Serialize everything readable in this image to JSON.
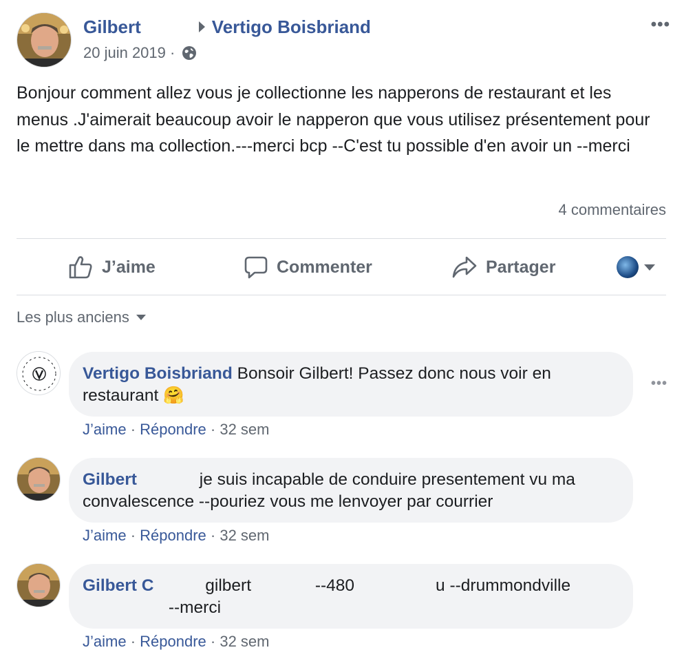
{
  "post": {
    "author": "Gilbert",
    "target_page": "Vertigo Boisbriand",
    "date": "20 juin 2019",
    "separator": " · ",
    "privacy_icon": "globe-icon",
    "more_icon": "more-dots-icon",
    "body": "Bonjour comment allez vous je collectionne les napperons de restaurant et les menus .J'aimerait beaucoup avoir le napperon que vous utilisez présentement pour le mettre dans ma collection.---merci bcp --C'est tu possible d'en avoir un --merci",
    "comments_count": "4 commentaires"
  },
  "actions": {
    "like": "J’aime",
    "comment": "Commenter",
    "share": "Partager"
  },
  "sort": {
    "label": "Les plus anciens"
  },
  "comments": [
    {
      "author": "Vertigo Boisbriand",
      "text": "Bonsoir Gilbert! Passez donc nous voir en restaurant",
      "emoji": "🤗",
      "like": "J’aime",
      "reply": "Répondre",
      "time": "32 sem"
    },
    {
      "author": "Gilbert",
      "text": "je suis incapable de conduire presentement vu ma convalescence --pouriez vous me lenvoyer par courrier",
      "like": "J’aime",
      "reply": "Répondre",
      "time": "32 sem"
    },
    {
      "author": "Gilbert C",
      "text_a": "gilbert",
      "text_b": "--480",
      "text_c": "u --drummondville",
      "text_d": "--merci",
      "like": "J’aime",
      "reply": "Répondre",
      "time": "32 sem"
    }
  ],
  "colors": {
    "link": "#385898",
    "secondary": "#606770",
    "bubble": "#f2f3f5",
    "divider": "#dadde1"
  }
}
